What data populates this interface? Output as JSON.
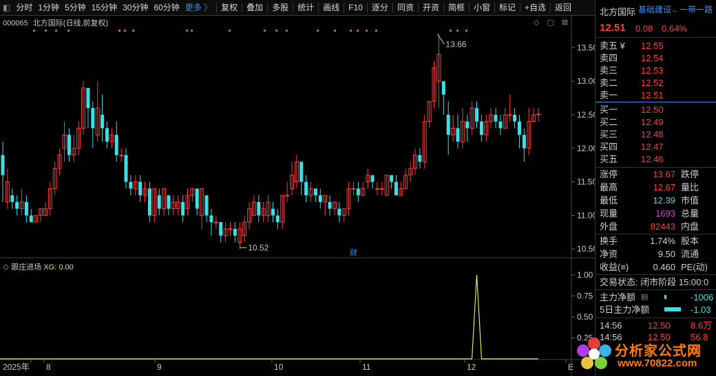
{
  "toolbar": {
    "left": [
      "分时",
      "1分钟",
      "5分钟",
      "15分钟",
      "30分钟",
      "60分钟"
    ],
    "more": "更多 〉",
    "right": [
      "复权",
      "叠加",
      "多股",
      "统计",
      "画线",
      "F10",
      "逐分",
      "同资",
      "开资",
      "简框",
      "小窗",
      "标记",
      "+自选",
      "返回"
    ]
  },
  "symbol": {
    "code": "000065",
    "name": "北方国际",
    "period": "(日线,前复权)"
  },
  "chart_controls": "◇ ▢ ⊠",
  "main_chart": {
    "y_ticks": [
      "13.50",
      "13.00",
      "12.50",
      "12.00",
      "11.50",
      "11.00",
      "10.50"
    ],
    "x_labels": [
      "2025年",
      "8",
      "9",
      "10",
      "11",
      "12",
      "E"
    ],
    "annotations": {
      "high": "13.66",
      "low": "10.52",
      "event": "财"
    }
  },
  "sub_chart": {
    "title": "跟庄进场",
    "xg_label": "XG: 0.00",
    "y_ticks": [
      "1.00",
      "0.75",
      "0.50",
      "0.25"
    ]
  },
  "chart_data": {
    "type": "candlestick",
    "note_series": "daily OHLC (12.51 last), indicator XG spike = 1.00 once",
    "ylim": [
      10.4,
      13.8
    ],
    "candles": [
      [
        11.9,
        11.6,
        12.1,
        11.2
      ],
      [
        11.2,
        11.5,
        11.7,
        11.1
      ],
      [
        11.3,
        11.2,
        11.4,
        11.1
      ],
      [
        11.2,
        11.1,
        11.3,
        11.0
      ],
      [
        11.1,
        11.2,
        11.4,
        11.0
      ],
      [
        11.2,
        11.0,
        11.3,
        10.9
      ],
      [
        11.0,
        10.9,
        11.1,
        10.9
      ],
      [
        10.9,
        11.0,
        11.0,
        10.9
      ],
      [
        11.0,
        11.1,
        11.1,
        10.9
      ],
      [
        11.0,
        11.1,
        11.2,
        11.0
      ],
      [
        11.1,
        11.4,
        11.5,
        11.0
      ],
      [
        11.4,
        11.7,
        11.8,
        11.3
      ],
      [
        11.7,
        11.9,
        12.0,
        11.6
      ],
      [
        12.0,
        12.2,
        12.4,
        11.8
      ],
      [
        12.2,
        11.9,
        12.3,
        11.8
      ],
      [
        11.9,
        12.0,
        12.2,
        11.8
      ],
      [
        12.0,
        12.3,
        12.4,
        11.9
      ],
      [
        12.3,
        12.9,
        13.0,
        12.2
      ],
      [
        12.9,
        12.6,
        12.9,
        12.3
      ],
      [
        12.6,
        12.3,
        12.7,
        12.0
      ],
      [
        12.2,
        12.6,
        13.0,
        12.1
      ],
      [
        12.5,
        12.3,
        12.8,
        12.1
      ],
      [
        12.3,
        12.1,
        12.4,
        12.0
      ],
      [
        12.1,
        12.2,
        12.3,
        12.0
      ],
      [
        12.2,
        11.9,
        12.4,
        11.8
      ],
      [
        11.9,
        11.9,
        12.0,
        11.8
      ],
      [
        11.9,
        11.5,
        12.0,
        11.4
      ],
      [
        11.5,
        11.4,
        11.6,
        11.3
      ],
      [
        11.4,
        11.5,
        11.6,
        11.3
      ],
      [
        11.5,
        11.3,
        11.6,
        11.2
      ],
      [
        11.3,
        11.4,
        11.5,
        11.2
      ],
      [
        11.4,
        11.0,
        11.5,
        10.9
      ],
      [
        11.0,
        11.4,
        11.4,
        10.9
      ],
      [
        11.3,
        11.1,
        11.4,
        11.0
      ],
      [
        11.1,
        11.4,
        11.4,
        11.0
      ],
      [
        11.3,
        11.1,
        11.3,
        11.0
      ],
      [
        11.1,
        11.2,
        11.3,
        11.0
      ],
      [
        11.1,
        11.2,
        11.3,
        11.0
      ],
      [
        11.2,
        11.0,
        11.3,
        10.9
      ],
      [
        11.1,
        11.3,
        11.4,
        11.0
      ],
      [
        11.3,
        11.4,
        11.4,
        11.2
      ],
      [
        11.4,
        11.1,
        11.4,
        11.0
      ],
      [
        11.0,
        11.4,
        11.4,
        10.8
      ],
      [
        11.3,
        11.0,
        11.3,
        10.9
      ],
      [
        11.0,
        10.9,
        11.1,
        10.7
      ],
      [
        10.9,
        10.9,
        11.0,
        10.8
      ],
      [
        10.9,
        10.7,
        10.9,
        10.6
      ],
      [
        10.7,
        10.8,
        10.9,
        10.6
      ],
      [
        10.8,
        10.8,
        10.9,
        10.7
      ],
      [
        10.8,
        10.7,
        10.9,
        10.6
      ],
      [
        10.6,
        10.8,
        10.9,
        10.5
      ],
      [
        10.7,
        10.9,
        11.0,
        10.6
      ],
      [
        10.9,
        11.1,
        11.2,
        10.8
      ],
      [
        11.0,
        11.2,
        11.3,
        11.0
      ],
      [
        11.2,
        11.0,
        11.3,
        10.9
      ],
      [
        11.0,
        11.1,
        11.2,
        10.9
      ],
      [
        11.0,
        11.2,
        11.3,
        10.9
      ],
      [
        11.1,
        11.0,
        11.2,
        10.9
      ],
      [
        11.0,
        10.9,
        11.1,
        10.8
      ],
      [
        10.9,
        11.3,
        11.3,
        10.8
      ],
      [
        11.3,
        11.3,
        11.5,
        11.2
      ],
      [
        11.4,
        11.6,
        11.8,
        11.3
      ],
      [
        11.5,
        11.8,
        11.9,
        11.4
      ],
      [
        11.8,
        11.5,
        11.8,
        11.3
      ],
      [
        11.5,
        11.3,
        11.6,
        11.2
      ],
      [
        11.3,
        11.4,
        11.5,
        11.2
      ],
      [
        11.4,
        11.3,
        11.4,
        11.2
      ],
      [
        11.3,
        11.2,
        11.4,
        11.1
      ],
      [
        11.2,
        11.3,
        11.3,
        11.0
      ],
      [
        11.2,
        11.1,
        11.3,
        11.0
      ],
      [
        11.1,
        11.2,
        11.2,
        11.0
      ],
      [
        11.1,
        11.0,
        11.2,
        10.9
      ],
      [
        11.0,
        11.1,
        11.1,
        10.9
      ],
      [
        11.1,
        11.4,
        11.5,
        11.0
      ],
      [
        11.4,
        11.4,
        11.5,
        11.3
      ],
      [
        11.4,
        11.3,
        11.5,
        11.2
      ],
      [
        11.3,
        11.4,
        11.5,
        11.3
      ],
      [
        11.5,
        11.6,
        11.7,
        11.4
      ],
      [
        11.6,
        11.5,
        11.6,
        11.4
      ],
      [
        11.4,
        11.4,
        11.5,
        11.3
      ],
      [
        11.4,
        11.4,
        11.5,
        11.3
      ],
      [
        11.3,
        11.6,
        11.6,
        11.3
      ],
      [
        11.6,
        11.5,
        11.6,
        11.4
      ],
      [
        11.5,
        11.3,
        11.6,
        11.3
      ],
      [
        11.3,
        11.4,
        11.5,
        11.3
      ],
      [
        11.4,
        11.6,
        11.7,
        11.4
      ],
      [
        11.6,
        11.7,
        11.8,
        11.5
      ],
      [
        11.7,
        11.9,
        12.0,
        11.6
      ],
      [
        11.9,
        11.8,
        12.0,
        11.7
      ],
      [
        11.8,
        12.4,
        12.5,
        11.7
      ],
      [
        12.4,
        12.7,
        12.7,
        12.3
      ],
      [
        12.7,
        13.2,
        13.3,
        12.6
      ],
      [
        13.0,
        13.4,
        13.7,
        12.6
      ],
      [
        13.0,
        12.8,
        13.0,
        12.5
      ],
      [
        12.5,
        12.2,
        12.7,
        11.9
      ],
      [
        12.2,
        12.3,
        12.5,
        12.1
      ],
      [
        12.3,
        12.1,
        12.5,
        12.0
      ],
      [
        12.1,
        12.4,
        12.6,
        12.0
      ],
      [
        12.4,
        12.3,
        12.5,
        12.1
      ],
      [
        12.3,
        12.6,
        12.7,
        12.2
      ],
      [
        12.6,
        12.4,
        12.7,
        12.3
      ],
      [
        12.4,
        12.2,
        12.5,
        12.1
      ],
      [
        12.2,
        12.4,
        12.5,
        12.1
      ],
      [
        12.4,
        12.5,
        12.6,
        12.3
      ],
      [
        12.5,
        12.4,
        12.6,
        12.3
      ],
      [
        12.4,
        12.3,
        12.5,
        12.2
      ],
      [
        12.3,
        12.5,
        12.6,
        12.3
      ],
      [
        12.5,
        12.5,
        12.8,
        12.4
      ],
      [
        12.5,
        12.4,
        12.6,
        12.3
      ],
      [
        12.4,
        12.2,
        12.5,
        12.0
      ],
      [
        12.2,
        12.0,
        12.3,
        11.8
      ],
      [
        12.0,
        12.4,
        12.6,
        11.9
      ],
      [
        12.4,
        12.5,
        12.6,
        12.4
      ],
      [
        12.5,
        12.51,
        12.6,
        12.4
      ]
    ],
    "xg": {
      "spike_index": 100,
      "spike_value": 1.0,
      "baseline": 0.0
    }
  },
  "quote": {
    "title": "北方国际",
    "tag": "基础建设←一带一路",
    "price": "12.51",
    "change": "0.08",
    "pct": "0.64%",
    "asks": [
      {
        "label": "卖五 ¥",
        "price": "12.55"
      },
      {
        "label": "卖四",
        "price": "12.54"
      },
      {
        "label": "卖三",
        "price": "12.53"
      },
      {
        "label": "卖二",
        "price": "12.52"
      },
      {
        "label": "卖一",
        "price": "12.51"
      }
    ],
    "bids": [
      {
        "label": "买一",
        "price": "12.50"
      },
      {
        "label": "买二",
        "price": "12.49"
      },
      {
        "label": "买三",
        "price": "12.48"
      },
      {
        "label": "买四",
        "price": "12.47"
      },
      {
        "label": "买五",
        "price": "12.46"
      }
    ],
    "stats": [
      {
        "l": "涨停",
        "v": "13.67",
        "c": "red",
        "l2": "跌停"
      },
      {
        "l": "最高",
        "v": "12.67",
        "c": "red",
        "l2": "量比"
      },
      {
        "l": "最低",
        "v": "12.39",
        "c": "cyan",
        "l2": "市值"
      },
      {
        "l": "现量",
        "v": "1693",
        "c": "mag",
        "l2": "总量"
      },
      {
        "l": "外盘",
        "v": "82443",
        "c": "red",
        "l2": "内盘"
      }
    ],
    "stats2": [
      {
        "l": "换手",
        "v": "1.74%",
        "c": "wht",
        "l2": "股本"
      },
      {
        "l": "净资",
        "v": "9.50",
        "c": "wht",
        "l2": "流通"
      },
      {
        "l": "收益(≡)",
        "v": "0.460",
        "c": "wht",
        "l2": "PE(动)"
      }
    ],
    "status": "交易状态: 闭市阶段 15:00:0",
    "flow": [
      {
        "l": "主力净额",
        "v": "-1006"
      },
      {
        "l": "5日主力净额",
        "v": "-1.03"
      }
    ],
    "ticks": [
      {
        "time": "14:56",
        "price": "12.50",
        "vol": "8.6万"
      },
      {
        "time": "14:56",
        "price": "12.50",
        "vol": "56.8万"
      }
    ]
  },
  "watermark": {
    "text": "分析家公式网",
    "url": "www.70822.com"
  }
}
